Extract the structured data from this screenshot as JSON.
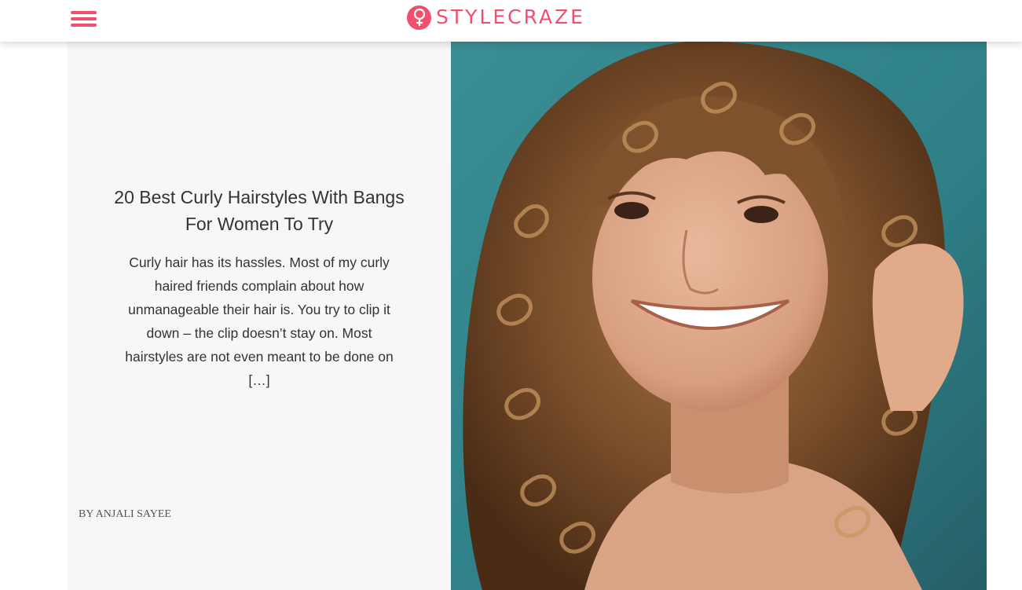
{
  "header": {
    "logo_text": "STYLECRAZE",
    "menu_icon": "hamburger-menu-icon",
    "logo_icon": "female-symbol-icon"
  },
  "article": {
    "title": "20 Best Curly Hairstyles With Bangs For Women To Try",
    "excerpt": "Curly hair has its hassles. Most of my curly haired friends complain about how unmanageable their hair is. You try to clip it down – the clip doesn’t stay on. Most hairstyles are not even meant to be done on […]",
    "byline": "BY ANJALI SAYEE",
    "image_description": "woman with curly hair and bangs smiling"
  },
  "colors": {
    "brand": "#f0506e",
    "card_background": "#f7f7f7",
    "text": "#333333",
    "hero_backdrop": "#2e8086"
  }
}
